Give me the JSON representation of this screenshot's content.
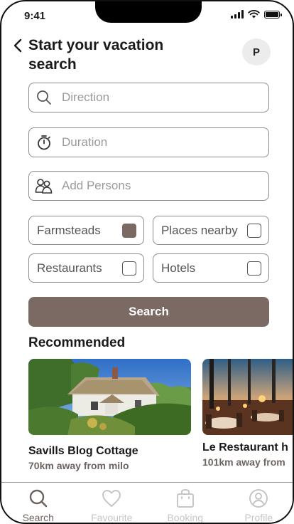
{
  "status_bar": {
    "time": "9:41"
  },
  "header": {
    "title": "Start your vacation search",
    "avatar_initial": "P"
  },
  "search_form": {
    "direction_placeholder": "Direction",
    "duration_placeholder": "Duration",
    "persons_placeholder": "Add Persons",
    "options": [
      {
        "label": "Farmsteads",
        "checked": true
      },
      {
        "label": "Places nearby",
        "checked": false
      },
      {
        "label": "Restaurants",
        "checked": false
      },
      {
        "label": "Hotels",
        "checked": false
      }
    ],
    "search_label": "Search"
  },
  "recommended": {
    "title": "Recommended",
    "cards": [
      {
        "title": "Savills Blog Cottage",
        "subtitle": "70km away from milo"
      },
      {
        "title": "Le Restaurant h",
        "subtitle": "101km away from"
      }
    ]
  },
  "tabbar": {
    "tabs": [
      {
        "label": "Search",
        "icon": "search-icon",
        "active": true
      },
      {
        "label": "Favourite",
        "icon": "heart-icon",
        "active": false
      },
      {
        "label": "Booking",
        "icon": "bag-icon",
        "active": false
      },
      {
        "label": "Profile",
        "icon": "user-icon",
        "active": false
      }
    ]
  },
  "colors": {
    "accent": "#7a6a63",
    "border": "#8f8a88",
    "inactive": "#c6c6c6"
  }
}
